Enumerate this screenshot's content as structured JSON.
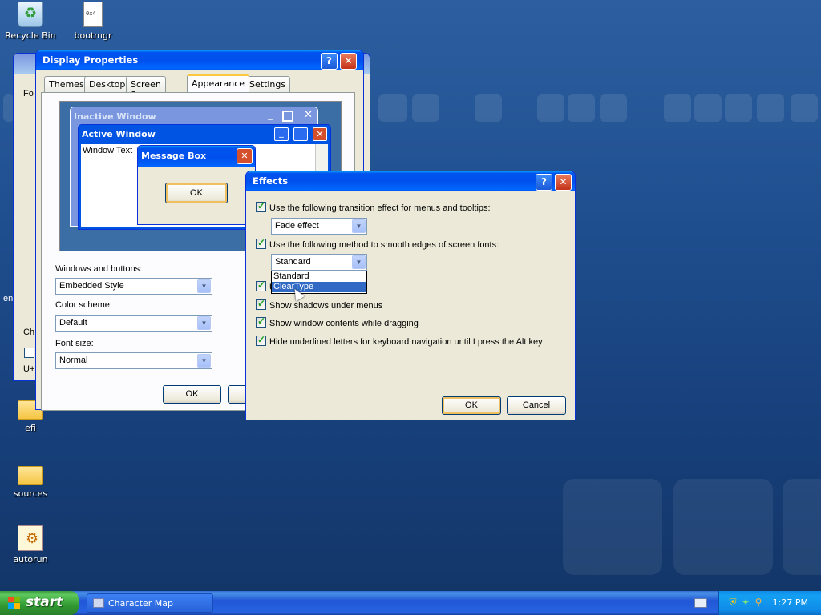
{
  "desktop": {
    "icons": [
      {
        "label": "Recycle Bin",
        "icon": "recycle-bin-icon"
      },
      {
        "label": "bootmgr",
        "icon": "file-icon"
      },
      {
        "label": "efi",
        "icon": "folder-icon"
      },
      {
        "label": "sources",
        "icon": "folder-icon"
      },
      {
        "label": "autorun",
        "icon": "autorun-icon"
      }
    ]
  },
  "background_window": {
    "fragments": [
      "Fo",
      "en",
      "Ch",
      "U+"
    ]
  },
  "display_properties": {
    "title": "Display Properties",
    "tabs": [
      "Themes",
      "Desktop",
      "Screen Saver",
      "Appearance",
      "Settings"
    ],
    "active_tab": "Appearance",
    "preview": {
      "inactive_title": "Inactive Window",
      "active_title": "Active Window",
      "window_text": "Window Text",
      "message_box_title": "Message Box",
      "message_box_ok": "OK"
    },
    "windows_buttons_label": "Windows and buttons:",
    "windows_buttons_value": "Embedded Style",
    "color_scheme_label": "Color scheme:",
    "color_scheme_value": "Default",
    "font_size_label": "Font size:",
    "font_size_value": "Normal",
    "ok_label": "OK"
  },
  "effects": {
    "title": "Effects",
    "opt_transition": "Use the following transition effect for menus and tooltips:",
    "transition_value": "Fade effect",
    "opt_smooth": "Use the following method to smooth edges of screen fonts:",
    "smooth_value": "Standard",
    "dropdown_items": [
      "Standard",
      "ClearType"
    ],
    "opt_large_icons_fragment": "U",
    "opt_shadows": "Show shadows under menus",
    "opt_drag": "Show window contents while dragging",
    "opt_underline": "Hide underlined letters for keyboard navigation until I press the Alt key",
    "ok_label": "OK",
    "cancel_label": "Cancel"
  },
  "taskbar": {
    "start_label": "start",
    "task_label": "Character Map",
    "clock": "1:27 PM"
  }
}
